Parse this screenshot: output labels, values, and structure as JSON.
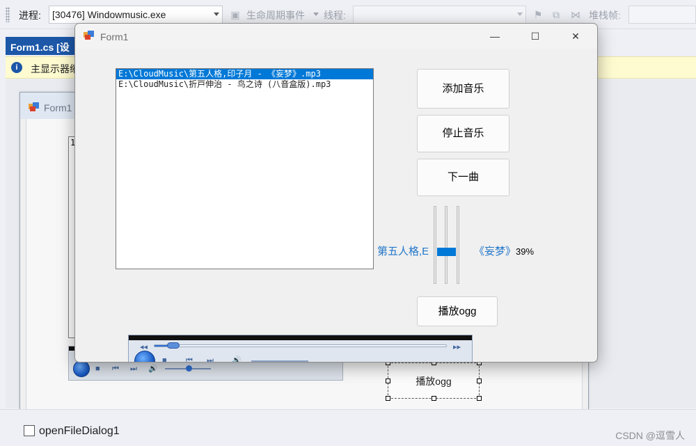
{
  "toolbar": {
    "process_label": "进程:",
    "process_value": "[30476] Windowmusic.exe",
    "lifecycle_label": "生命周期事件",
    "thread_label": "线程:",
    "thread_value": "",
    "stackframe_label": "堆栈帧:",
    "stackframe_value": ""
  },
  "designer": {
    "doc_tab": "Form1.cs [设",
    "info_text": "主显示器缩",
    "form_title": "Form1",
    "listbox_fragment": "1",
    "button_label": "播放ogg"
  },
  "tray": {
    "component": "openFileDialog1"
  },
  "watermark": "CSDN @逗雪人",
  "app": {
    "title": "Form1",
    "minimize": "—",
    "maximize": "☐",
    "close": "✕",
    "playlist": [
      "E:\\CloudMusic\\第五人格,印子月 - 《妄梦》.mp3",
      "E:\\CloudMusic\\折戸伸治 - 鸟之诗 (八音盒版).mp3"
    ],
    "selected_index": 0,
    "buttons": {
      "add": "添加音乐",
      "stop": "停止音乐",
      "next": "下一曲",
      "play_ogg": "播放ogg"
    },
    "marquee_left": "第五人格,E",
    "marquee_right": "《妄梦》",
    "volume_percent": "39%",
    "volume_level": 0.39
  },
  "colors": {
    "accent": "#0078d7",
    "vs_tab": "#1c57a8",
    "info_bar": "#fefbd0",
    "marquee_text": "#2276c9"
  },
  "icons": {
    "form": "form-icon",
    "info": "info-icon",
    "dialog": "open-file-dialog-icon"
  }
}
